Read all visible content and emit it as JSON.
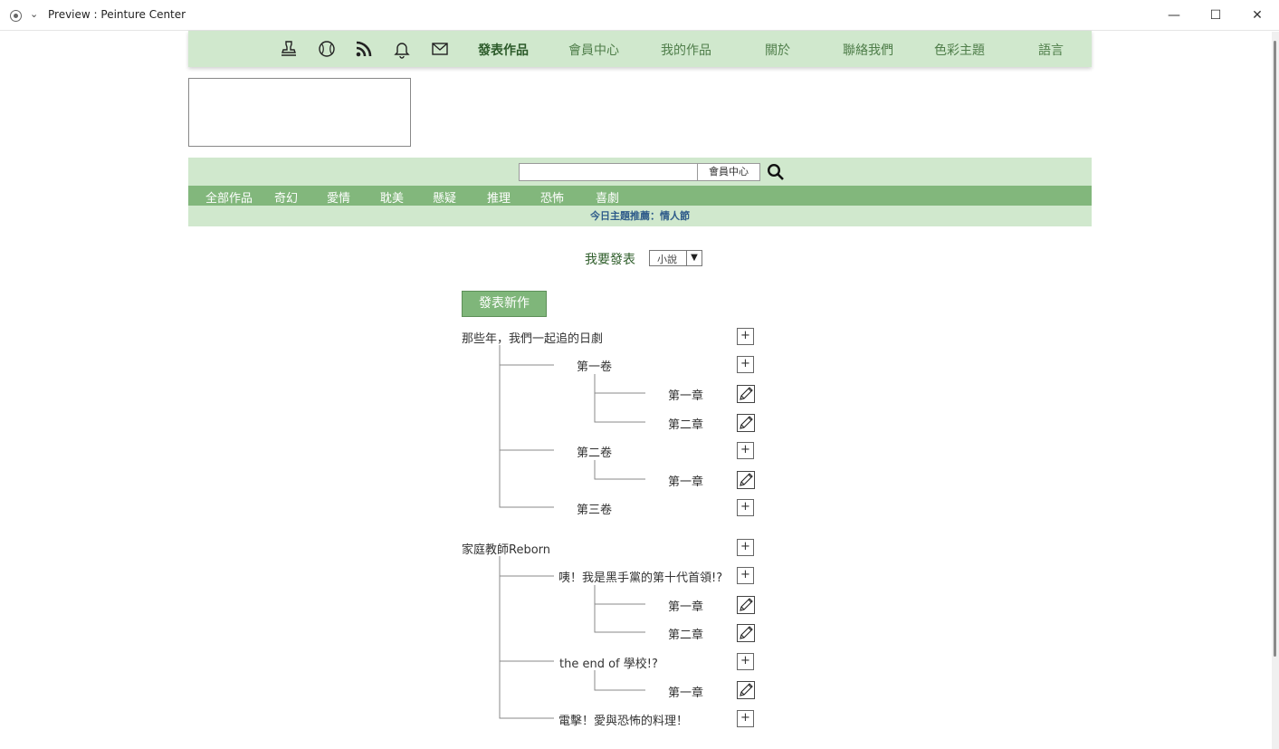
{
  "window": {
    "title": "Preview : Peinture Center"
  },
  "topnav": {
    "icons": [
      "stamp-icon",
      "baseball-icon",
      "rss-icon",
      "bell-icon",
      "mail-icon"
    ],
    "links": [
      "發表作品",
      "會員中心",
      "我的作品",
      "關於",
      "聯絡我們",
      "色彩主題",
      "語言"
    ]
  },
  "search": {
    "value": "",
    "scope": "會員中心"
  },
  "categories": [
    "全部作品",
    "奇幻",
    "愛情",
    "耽美",
    "懸疑",
    "推理",
    "恐怖",
    "喜劇"
  ],
  "theme_text": "今日主題推薦：情人節",
  "publish": {
    "label": "我要發表",
    "type": "小說",
    "new_button": "發表新作"
  },
  "works": [
    {
      "title": "那些年，我們一起追的日劇",
      "volumes": [
        {
          "title": "第一卷",
          "chapters": [
            "第一章",
            "第二章"
          ]
        },
        {
          "title": "第二卷",
          "chapters": [
            "第一章"
          ]
        },
        {
          "title": "第三卷",
          "chapters": []
        }
      ]
    },
    {
      "title": "家庭教師Reborn",
      "volumes": [
        {
          "title": "咦！我是黑手黨的第十代首領!?",
          "chapters": [
            "第一章",
            "第二章"
          ]
        },
        {
          "title": "the end of 學校!?",
          "chapters": [
            "第一章"
          ]
        },
        {
          "title": "電擊！愛與恐怖的料理！",
          "chapters": []
        }
      ]
    }
  ],
  "colors": {
    "nav_bg": "#d0e8cd",
    "accent": "#82b77c",
    "theme_text": "#2e5b8a"
  }
}
